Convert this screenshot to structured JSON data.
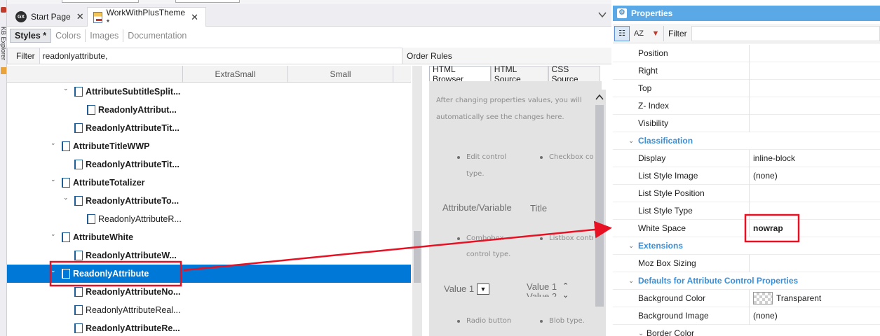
{
  "side_strip": {
    "label": "KB Explorer"
  },
  "tabs": [
    {
      "label": "Start Page",
      "icon": "genexus-icon"
    },
    {
      "label": "WorkWithPlusTheme *",
      "icon": "theme-icon"
    }
  ],
  "subtabs": [
    {
      "label": "Styles *"
    },
    {
      "label": "Colors"
    },
    {
      "label": "Images"
    },
    {
      "label": "Documentation"
    }
  ],
  "filter": {
    "label": "Filter",
    "value": "readonlyattribute,"
  },
  "order_rules": {
    "label": "Order Rules"
  },
  "columns": [
    "ExtraSmall",
    "Small"
  ],
  "tree": [
    {
      "label": "AttributeSubtitleSplit...",
      "level": 1,
      "bold": true,
      "chevron": true
    },
    {
      "label": "ReadonlyAttribut...",
      "level": 2,
      "bold": true,
      "chevron": false
    },
    {
      "label": "ReadonlyAttributeTit...",
      "level": 1,
      "bold": true,
      "chevron": false
    },
    {
      "label": "AttributeTitleWWP",
      "level": 0,
      "bold": true,
      "chevron": true
    },
    {
      "label": "ReadonlyAttributeTit...",
      "level": 1,
      "bold": true,
      "chevron": false
    },
    {
      "label": "AttributeTotalizer",
      "level": 0,
      "bold": true,
      "chevron": true
    },
    {
      "label": "ReadonlyAttributeTo...",
      "level": 1,
      "bold": true,
      "chevron": true
    },
    {
      "label": "ReadonlyAttributeR...",
      "level": 2,
      "bold": false,
      "chevron": false
    },
    {
      "label": "AttributeWhite",
      "level": 0,
      "bold": true,
      "chevron": true
    },
    {
      "label": "ReadonlyAttributeW...",
      "level": 1,
      "bold": true,
      "chevron": false
    },
    {
      "label": "ReadonlyAttribute",
      "level": 0,
      "bold": true,
      "chevron": true,
      "selected": true
    },
    {
      "label": "ReadonlyAttributeNo...",
      "level": 1,
      "bold": true,
      "chevron": false
    },
    {
      "label": "ReadonlyAttributeReal...",
      "level": 1,
      "bold": false,
      "chevron": false
    },
    {
      "label": "ReadonlyAttributeRe...",
      "level": 1,
      "bold": true,
      "chevron": false
    }
  ],
  "preview_tabs": [
    {
      "label": "HTML Browser"
    },
    {
      "label": "HTML Source"
    },
    {
      "label": "CSS Source"
    }
  ],
  "preview": {
    "intro_line1": "After changing properties values, you will",
    "intro_line2": "automatically see the changes here.",
    "edit_control_1": "Edit control",
    "edit_control_2": "type.",
    "checkbox": "Checkbox co",
    "attr_variable": "Attribute/Variable",
    "title": "Title",
    "combobox_1": "Combobox",
    "combobox_2": "control type.",
    "listbox": "Listbox contr",
    "value1_select": "Value 1",
    "value1_list": "Value 1",
    "value2_list": "Value 2",
    "radio_button": "Radio button",
    "blob": "Blob type."
  },
  "properties": {
    "title": "Properties",
    "filter_label": "Filter",
    "rows": [
      {
        "name": "Position",
        "value": "",
        "type": "row"
      },
      {
        "name": "Right",
        "value": "",
        "type": "row"
      },
      {
        "name": "Top",
        "value": "",
        "type": "row"
      },
      {
        "name": "Z- Index",
        "value": "",
        "type": "row"
      },
      {
        "name": "Visibility",
        "value": "",
        "type": "row"
      },
      {
        "name": "Classification",
        "value": "",
        "type": "cat"
      },
      {
        "name": "Display",
        "value": "inline-block",
        "type": "row"
      },
      {
        "name": "List Style Image",
        "value": "(none)",
        "type": "row"
      },
      {
        "name": "List Style Position",
        "value": "",
        "type": "row"
      },
      {
        "name": "List Style Type",
        "value": "",
        "type": "row"
      },
      {
        "name": "White Space",
        "value": "nowrap",
        "type": "row",
        "bold": true,
        "highlighted": true
      },
      {
        "name": "Extensions",
        "value": "",
        "type": "cat"
      },
      {
        "name": "Moz Box Sizing",
        "value": "",
        "type": "row"
      },
      {
        "name": "Defaults for Attribute Control Properties",
        "value": "",
        "type": "cat"
      },
      {
        "name": "Background Color",
        "value": "Transparent",
        "type": "row",
        "swatch": true
      },
      {
        "name": "Background Image",
        "value": "(none)",
        "type": "row"
      },
      {
        "name": "Border Color",
        "value": "",
        "type": "sub"
      }
    ]
  },
  "colors": {
    "selection": "#0078d7",
    "category": "#3a8fd9",
    "annotation": "#e81123",
    "props_header": "#5aa9e6"
  }
}
